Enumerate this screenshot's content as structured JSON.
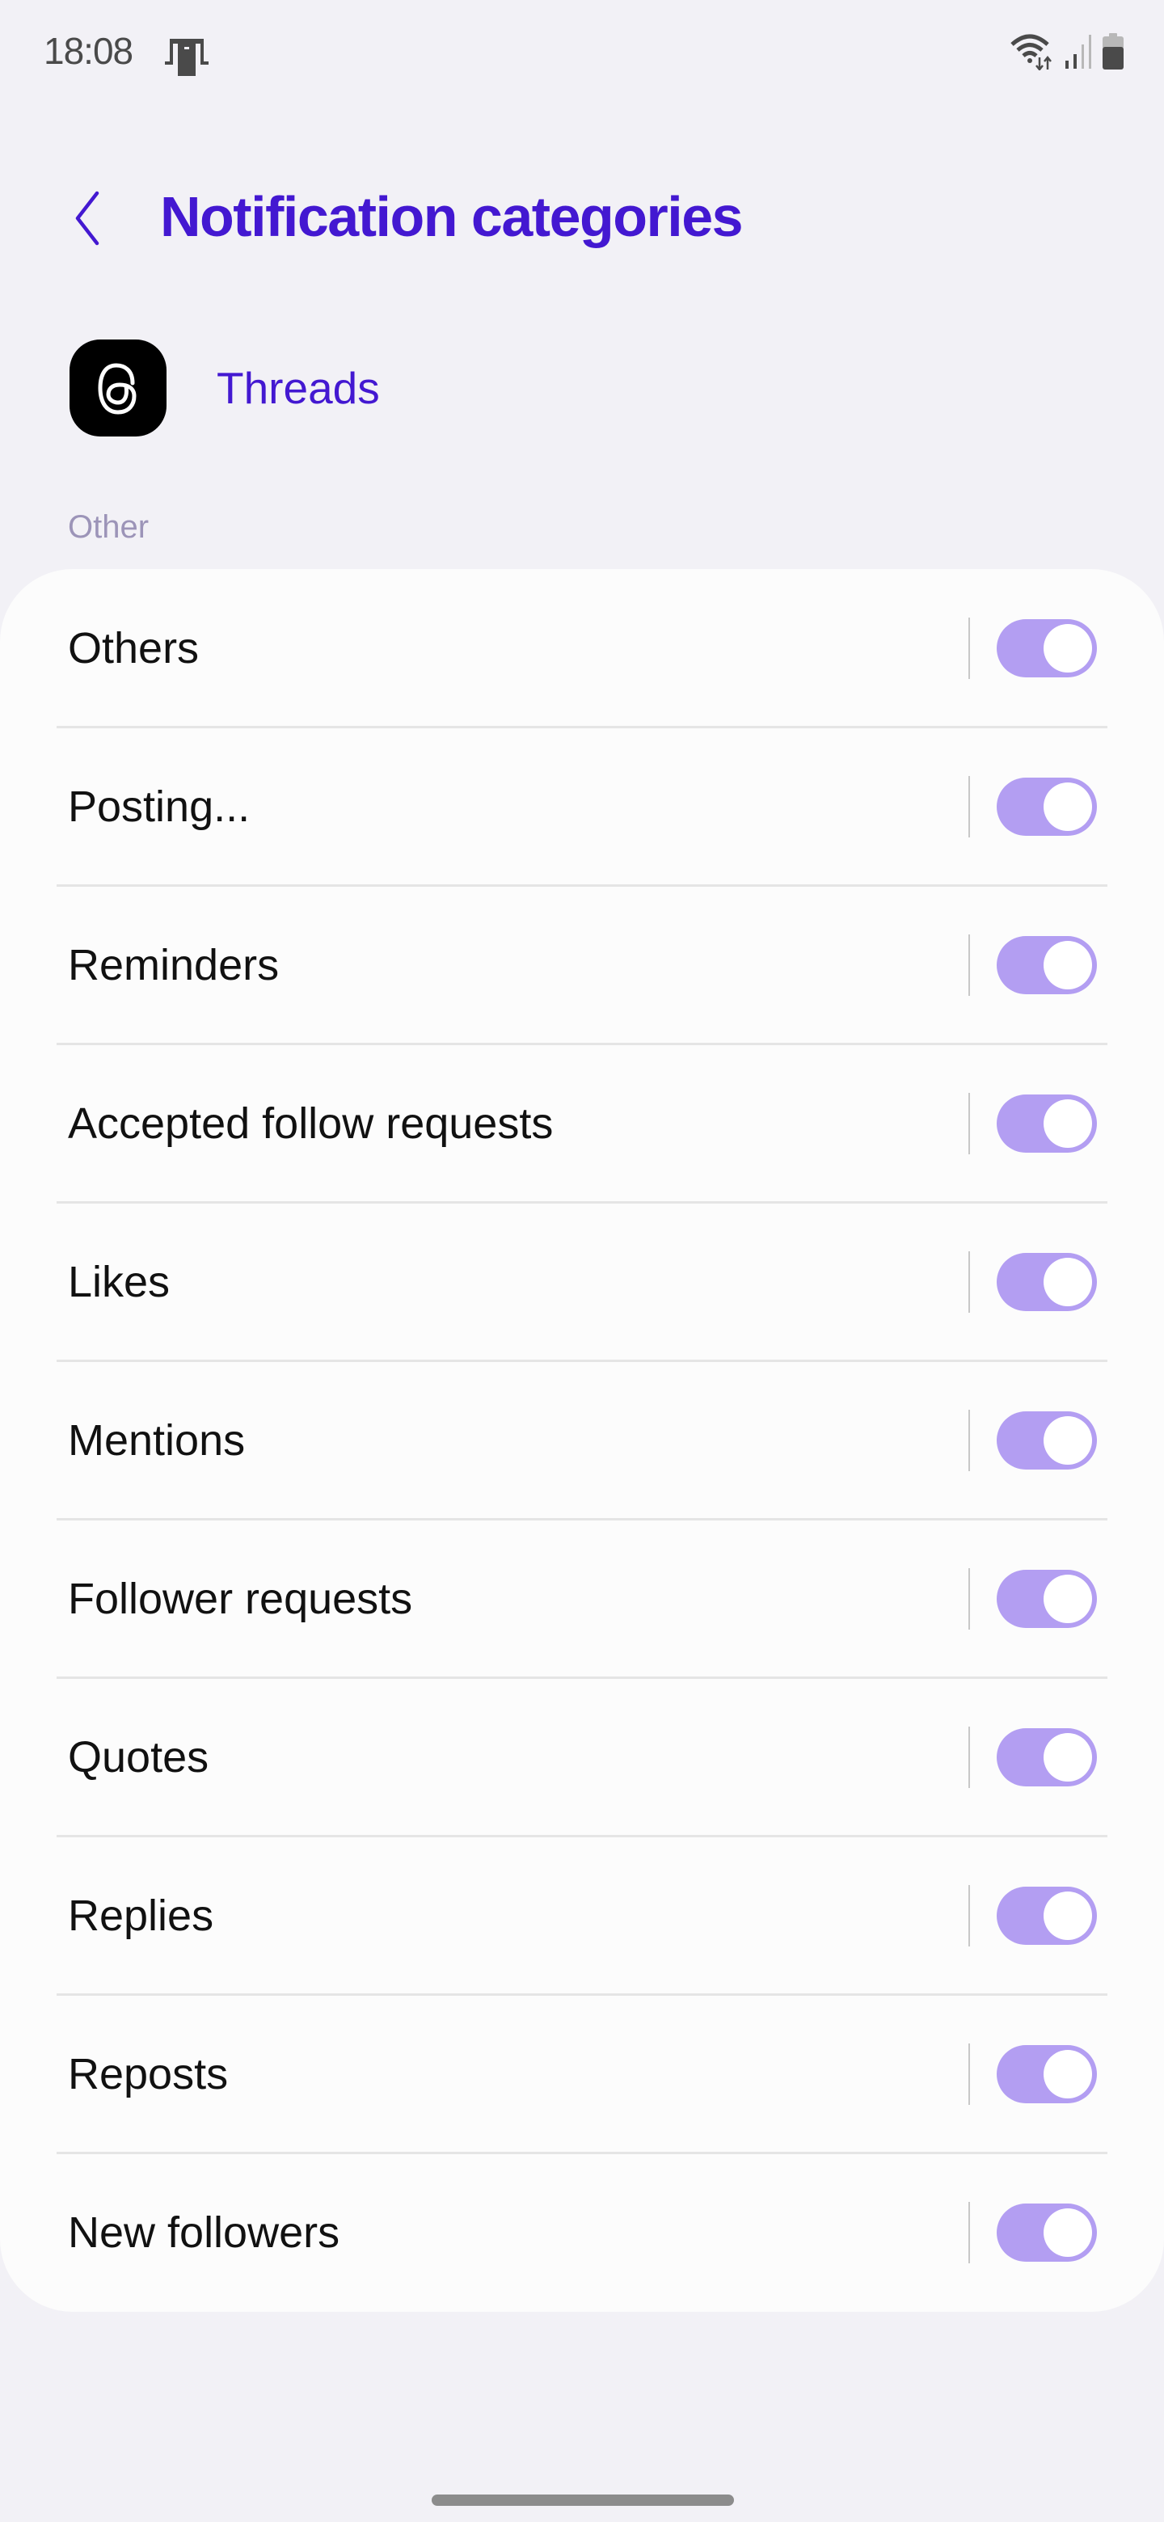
{
  "status_bar": {
    "time": "18:08",
    "left_icons": [
      "cast-notification-icon"
    ],
    "right_icons": [
      "wifi-icon",
      "signal-icon",
      "battery-icon"
    ]
  },
  "header": {
    "back_icon": "chevron-left-icon",
    "title": "Notification categories"
  },
  "app": {
    "name": "Threads",
    "icon": "threads-logo-icon"
  },
  "section": {
    "label": "Other"
  },
  "categories": [
    {
      "label": "Others",
      "enabled": true
    },
    {
      "label": "Posting...",
      "enabled": true
    },
    {
      "label": "Reminders",
      "enabled": true
    },
    {
      "label": "Accepted follow requests",
      "enabled": true
    },
    {
      "label": "Likes",
      "enabled": true
    },
    {
      "label": "Mentions",
      "enabled": true
    },
    {
      "label": "Follower requests",
      "enabled": true
    },
    {
      "label": "Quotes",
      "enabled": true
    },
    {
      "label": "Replies",
      "enabled": true
    },
    {
      "label": "Reposts",
      "enabled": true
    },
    {
      "label": "New followers",
      "enabled": true
    }
  ],
  "colors": {
    "accent": "#4318d1",
    "toggle_on": "#b39ef2",
    "background": "#f2f1f6",
    "card": "#fcfcfc",
    "section_label": "#9c94b8"
  }
}
